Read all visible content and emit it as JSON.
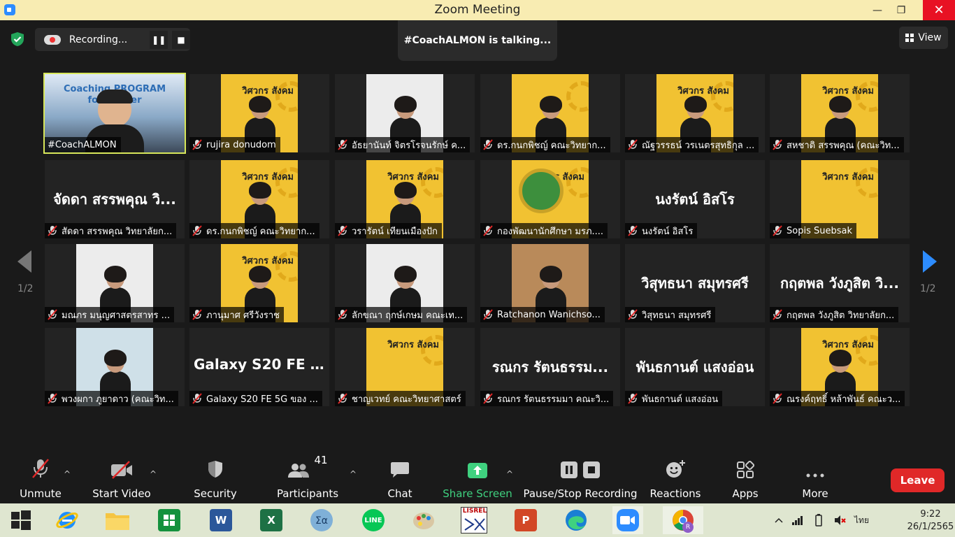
{
  "window": {
    "title": "Zoom Meeting",
    "minimize": "—",
    "maximize": "❐",
    "close": "✕"
  },
  "meeting": {
    "recording_label": "Recording...",
    "pause_glyph": "❚❚",
    "stop_glyph": "■",
    "talking_banner": "#CoachALMON is talking...",
    "view_label": "View",
    "page_indicator_left": "1/2",
    "page_indicator_right": "1/2",
    "colors": {
      "accent_blue": "#2d8cff",
      "active_speaker": "#d7e65a",
      "muted_red": "#e02828",
      "green": "#3fd17f"
    }
  },
  "tiles": [
    {
      "name": "#CoachALMON",
      "thumb": "coach",
      "thumb_text": "Coaching PROGRAM for Trainer",
      "muted": false,
      "active": true
    },
    {
      "name": "rujira donudom",
      "thumb": "poster-person",
      "thumb_text": "วิศวกร สังคม",
      "muted": true
    },
    {
      "name": "อัธยานันท์ จิตรโรจนรักษ์ ค...",
      "thumb": "photo",
      "thumb_text": "",
      "muted": true
    },
    {
      "name": "ดร.กนกพิชญ์ คณะวิทยาก...",
      "thumb": "poster-person",
      "thumb_text": "",
      "muted": true
    },
    {
      "name": "ณัฐวรรธน์ วรเนตรสุทธิกุล ...",
      "thumb": "poster-person",
      "thumb_text": "วิศวกร สังคม",
      "muted": true
    },
    {
      "name": "สหชาติ สรรพคุณ (คณะวิท...",
      "thumb": "poster-person",
      "thumb_text": "วิศวกร สังคม",
      "muted": true
    },
    {
      "name": "สัดดา สรรพคุณ วิทยาลัยก...",
      "big": "จัดดา สรรพคุณ วิ...",
      "muted": true
    },
    {
      "name": "ดร.กนกพิชญ์ คณะวิทยาก...",
      "thumb": "poster-person",
      "thumb_text": "วิศวกร สังคม",
      "muted": true
    },
    {
      "name": "วรารัตน์ เทียนเมืองปัก",
      "thumb": "poster-person",
      "thumb_text": "วิศวกร สังคม",
      "muted": true
    },
    {
      "name": "กองพัฒนานักศึกษา มรภ....",
      "thumb": "poster-logo",
      "thumb_text": "วิศวกร สังคม",
      "muted": true
    },
    {
      "name": "นงรัตน์ อิสโร",
      "big": "นงรัตน์ อิสโร",
      "muted": true
    },
    {
      "name": "Sopis Suebsak",
      "thumb": "poster",
      "thumb_text": "วิศวกร สังคม",
      "muted": true
    },
    {
      "name": "มณภร มนุญศาสตรสาทร ...",
      "thumb": "photo",
      "thumb_text": "",
      "muted": true
    },
    {
      "name": "ภานุมาศ ศรีวังราช",
      "thumb": "poster-person",
      "thumb_text": "วิศวกร สังคม",
      "muted": true
    },
    {
      "name": "ลักขณา ฤกษ์เกษม คณะเท...",
      "thumb": "photo",
      "thumb_text": "",
      "muted": true
    },
    {
      "name": "Ratchanon Wanichso...",
      "thumb": "photo2",
      "thumb_text": "",
      "muted": true
    },
    {
      "name": "วิสุทธนา สมุทรศรี",
      "big": "วิสุทธนา สมุทรศรี",
      "muted": true
    },
    {
      "name": "กฤตพล วังภูสิต วิทยาลัยก...",
      "big": "กฤตพล วังภูสิต วิ...",
      "muted": true
    },
    {
      "name": "พวงผกา ภูยาดาว (คณะวิท...",
      "thumb": "photo3",
      "thumb_text": "",
      "muted": true
    },
    {
      "name": "Galaxy S20 FE 5G ของ ...",
      "big": "Galaxy S20 FE 5...",
      "muted": true
    },
    {
      "name": "ชาญเวทย์  คณะวิทยาศาสตร์",
      "thumb": "poster",
      "thumb_text": "วิศวกร สังคม",
      "muted": true
    },
    {
      "name": "รณกร รัตนธรรมมา คณะวิ...",
      "big": "รณกร รัตนธรรม...",
      "muted": true
    },
    {
      "name": "พันธกานต์ แสงอ่อน",
      "big": "พันธกานต์ แสงอ่อน",
      "muted": true
    },
    {
      "name": "ณรงค์ฤทธิ์ หล้าพันธ์ คณะว...",
      "thumb": "poster-person",
      "thumb_text": "วิศวกร สังคม",
      "muted": true
    }
  ],
  "toolbar": {
    "unmute": "Unmute",
    "start_video": "Start Video",
    "security": "Security",
    "participants": "Participants",
    "participants_count": "41",
    "chat": "Chat",
    "share_screen": "Share Screen",
    "pause_stop_recording": "Pause/Stop Recording",
    "reactions": "Reactions",
    "apps": "Apps",
    "more": "More",
    "leave": "Leave",
    "caret": "^"
  },
  "taskbar": {
    "apps": [
      "start",
      "internet-explorer",
      "file-explorer",
      "store",
      "word",
      "excel",
      "math-input",
      "line",
      "paint",
      "lisrel",
      "powerpoint",
      "edge",
      "zoom",
      "chrome"
    ],
    "excel_letter": "X",
    "word_letter": "W",
    "ppt_letter": "P",
    "line_text": "LINE",
    "lisrel_text": "LISREL",
    "chrome_badge": "R",
    "tray_lang": "ไทย",
    "time": "9:22",
    "date": "26/1/2565"
  }
}
